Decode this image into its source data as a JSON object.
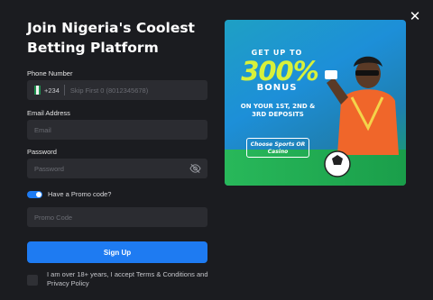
{
  "modal": {
    "title": "Join Nigeria's Coolest Betting Platform",
    "close_icon": "close-icon"
  },
  "form": {
    "phone": {
      "label": "Phone Number",
      "country_code": "+234",
      "placeholder": "Skip First 0 (8012345678)"
    },
    "email": {
      "label": "Email Address",
      "placeholder": "Email"
    },
    "password": {
      "label": "Password",
      "placeholder": "Password",
      "icon": "eye-off-icon"
    },
    "promo": {
      "toggle_label": "Have a Promo code?",
      "toggle_on": true,
      "placeholder": "Promo Code"
    },
    "signup_label": "Sign Up",
    "terms_text": "I am over 18+ years, I accept Terms & Conditions and Privacy Policy"
  },
  "banner": {
    "get_up_to": "GET UP TO",
    "percent": "300%",
    "bonus": "BONUS",
    "subtitle": "ON YOUR 1ST, 2ND & 3RD DEPOSITS",
    "cta": "Choose Sports OR Casino"
  },
  "colors": {
    "accent": "#1e7bf2",
    "background": "#1b1c20",
    "field": "#2b2c31",
    "bonus_yellow": "#d8f13a"
  }
}
